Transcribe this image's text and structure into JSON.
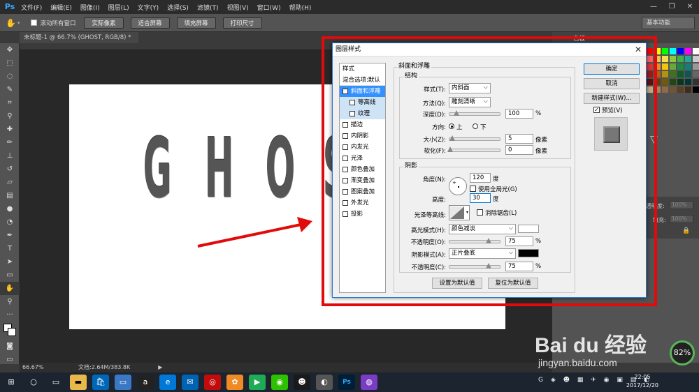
{
  "app": {
    "menu": [
      "文件(F)",
      "编辑(E)",
      "图像(I)",
      "图层(L)",
      "文字(Y)",
      "选择(S)",
      "滤镜(T)",
      "视图(V)",
      "窗口(W)",
      "帮助(H)"
    ],
    "window_controls": [
      "—",
      "❐",
      "✕"
    ]
  },
  "options": {
    "scroll_all": "滚动所有窗口",
    "buttons": [
      "实际像素",
      "适合屏幕",
      "填充屏幕",
      "打印尺寸"
    ],
    "workspace": "基本功能"
  },
  "doc_tab": "未标题-1 @ 66.7% (GHOST, RGB/8) *",
  "canvas_text": [
    "G",
    "H",
    "O",
    "S"
  ],
  "status": {
    "zoom": "66.67%",
    "doc": "文档:2.64M/383.8K"
  },
  "right_panel": {
    "tab_label": "色板",
    "opacity_label": "透明度:",
    "opacity_value": "100%",
    "fill_label": "填充:",
    "fill_value": "100%"
  },
  "dialog": {
    "title": "图层样式",
    "styles_header": "样式",
    "blend_default": "混合选项:默认",
    "styles": [
      {
        "label": "斜面和浮雕",
        "checked": true,
        "selected": true,
        "sub": false
      },
      {
        "label": "等高线",
        "checked": false,
        "selected": false,
        "sub": true
      },
      {
        "label": "纹理",
        "checked": false,
        "selected": false,
        "sub": true
      },
      {
        "label": "描边",
        "checked": false,
        "sub": false
      },
      {
        "label": "内阴影",
        "checked": false,
        "sub": false
      },
      {
        "label": "内发光",
        "checked": false,
        "sub": false
      },
      {
        "label": "光泽",
        "checked": false,
        "sub": false
      },
      {
        "label": "颜色叠加",
        "checked": false,
        "sub": false
      },
      {
        "label": "渐变叠加",
        "checked": false,
        "sub": false
      },
      {
        "label": "图案叠加",
        "checked": false,
        "sub": false
      },
      {
        "label": "外发光",
        "checked": false,
        "sub": false
      },
      {
        "label": "投影",
        "checked": false,
        "sub": false
      }
    ],
    "section": "斜面和浮雕",
    "structure": {
      "title": "结构",
      "style_label": "样式(T):",
      "style_value": "内斜面",
      "method_label": "方法(Q):",
      "method_value": "雕刻清晰",
      "depth_label": "深度(D):",
      "depth_value": "100",
      "depth_unit": "%",
      "direction_label": "方向:",
      "dir_up": "上",
      "dir_down": "下",
      "size_label": "大小(Z):",
      "size_value": "5",
      "size_unit": "像素",
      "soften_label": "软化(F):",
      "soften_value": "0",
      "soften_unit": "像素"
    },
    "shading": {
      "title": "阴影",
      "angle_label": "角度(N):",
      "angle_value": "120",
      "angle_unit": "度",
      "global_light": "使用全局光(G)",
      "altitude_label": "高度:",
      "altitude_value": "30",
      "altitude_unit": "度",
      "gloss_label": "光泽等高线:",
      "antialias": "消除锯齿(L)",
      "highlight_label": "高光模式(H):",
      "highlight_value": "颜色减淡",
      "highlight_color": "#ffffff",
      "hl_opacity_label": "不透明度(O):",
      "hl_opacity_value": "75",
      "hl_opacity_unit": "%",
      "shadow_label": "阴影模式(A):",
      "shadow_value": "正片叠底",
      "shadow_color": "#000000",
      "sh_opacity_label": "不透明度(C):",
      "sh_opacity_value": "75",
      "sh_opacity_unit": "%"
    },
    "make_default": "设置为默认值",
    "reset_default": "复位为默认值",
    "ok": "确定",
    "cancel": "取消",
    "new_style": "新建样式(W)...",
    "preview": "预览(V)"
  },
  "taskbar": {
    "time": "22:05",
    "date": "2017/12/20",
    "cpu": "82%",
    "watermark": "Bai du 经验",
    "watermark_url": "jingyan.baidu.com"
  }
}
